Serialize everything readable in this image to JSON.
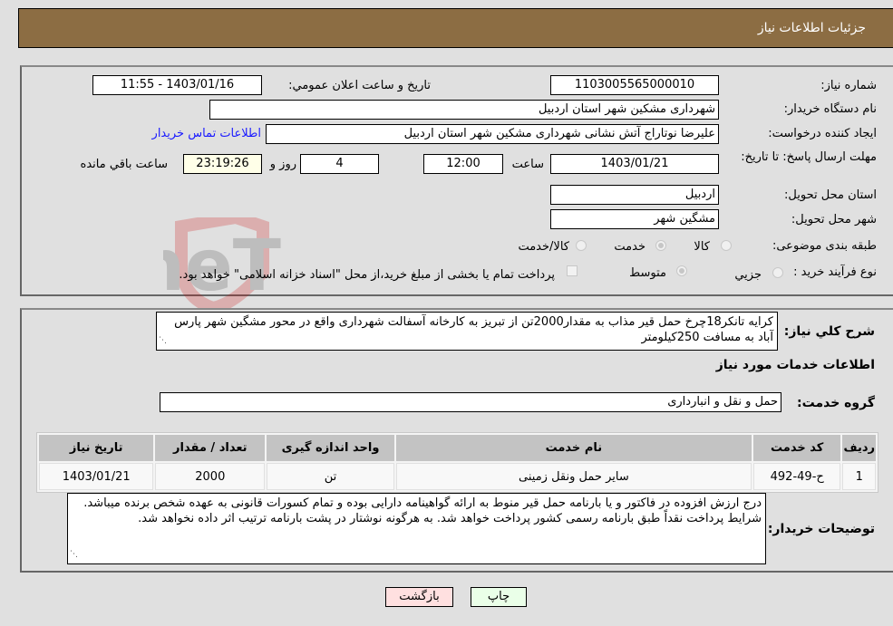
{
  "header": {
    "title": "جزئیات اطلاعات نیاز"
  },
  "fields": {
    "need_number_label": "شماره نیاز:",
    "need_number": "1103005565000010",
    "announce_label": "تاریخ و ساعت اعلان عمومي:",
    "announce_value": "1403/01/16 - 11:55",
    "buyer_org_label": "نام دستگاه خریدار:",
    "buyer_org": "شهرداری مشکین شهر استان اردبیل",
    "creator_label": "ایجاد کننده درخواست:",
    "creator": "علیرضا نوتاراج آتش نشانی شهرداری مشکین شهر استان اردبیل",
    "contact_link": "اطلاعات تماس خریدار",
    "deadline_label": "مهلت ارسال پاسخ: تا تاریخ:",
    "deadline_date": "1403/01/21",
    "time_label": "ساعت",
    "deadline_time": "12:00",
    "days": "4",
    "days_label": "روز و",
    "remaining_time": "23:19:26",
    "remaining_label": "ساعت باقي مانده",
    "province_label": "استان محل تحویل:",
    "province": "اردبیل",
    "city_label": "شهر محل تحویل:",
    "city": "مشگین شهر",
    "category_label": "طبقه بندی موضوعی:",
    "category_options": [
      "کالا",
      "خدمت",
      "کالا/خدمت"
    ],
    "category_selected": "خدمت",
    "process_label": "نوع فرآیند خرید :",
    "process_options": [
      "جزیي",
      "متوسط"
    ],
    "process_selected": "متوسط",
    "treasury_note": "پرداخت تمام یا بخشی از مبلغ خرید،از محل \"اسناد خزانه اسلامی\" خواهد بود."
  },
  "description": {
    "label": "شرح کلي نیاز:",
    "text": "کرایه تانکر18چرخ حمل قیر مذاب به مقدار2000تن  از تبریز به کارخانه آسفالت شهرداری واقع  در محور مشگین شهر پارس آباد به مسافت 250کیلومتر"
  },
  "services": {
    "section_title": "اطلاعات خدمات مورد نیاز",
    "group_label": "گروه خدمت:",
    "group_value": "حمل و نقل و انبارداری",
    "columns": [
      "ردیف",
      "کد خدمت",
      "نام خدمت",
      "واحد اندازه گیری",
      "تعداد / مقدار",
      "تاریخ نیاز"
    ],
    "rows": [
      [
        "1",
        "ح-49-492",
        "سایر حمل ونقل زمینی",
        "تن",
        "2000",
        "1403/01/21"
      ]
    ]
  },
  "buyer_notes": {
    "label": "توضیحات خریدار:",
    "text": "درج ارزش افزوده در فاکتور و یا بارنامه حمل قیر منوط به ارائه گواهینامه دارایی بوده و تمام کسورات قانونی به عهده شخص برنده میباشد. شرایط پرداخت نقداً طبق بارنامه رسمی کشور پرداخت خواهد شد. به هرگونه نوشتار در پشت بارنامه ترتیب اثر داده نخواهد شد."
  },
  "buttons": {
    "print": "چاپ",
    "back": "بازگشت"
  },
  "watermark": {
    "text": "AriaTender.neT"
  }
}
